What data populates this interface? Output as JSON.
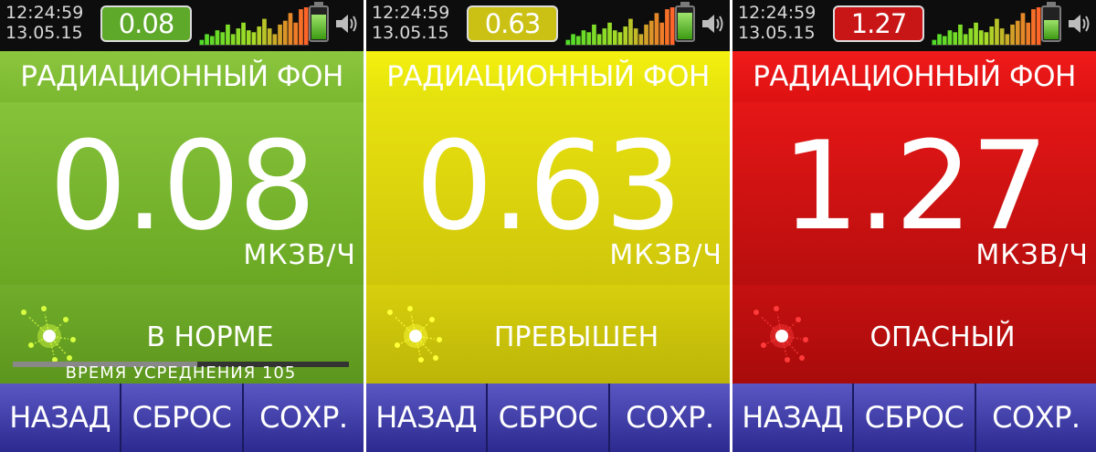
{
  "screens": [
    {
      "theme": "green",
      "time": "12:24:59",
      "date": "13.05.15",
      "mini_value": "0.08",
      "title": "РАДИАЦИОННЫЙ ФОН",
      "reading": "0.08",
      "unit": "МКЗВ/Ч",
      "state": "В НОРМЕ",
      "averaging": "ВРЕМЯ УСРЕДНЕНИЯ 105",
      "averaging_progress": 0.55,
      "icon_color": "#d8ff40",
      "buttons": [
        "НАЗАД",
        "СБРОС",
        "СОХР."
      ]
    },
    {
      "theme": "yellow",
      "time": "12:24:59",
      "date": "13.05.15",
      "mini_value": "0.63",
      "title": "РАДИАЦИОННЫЙ ФОН",
      "reading": "0.63",
      "unit": "МКЗВ/Ч",
      "state": "ПРЕВЫШЕН",
      "icon_color": "#ffff3a",
      "buttons": [
        "НАЗАД",
        "СБРОС",
        "СОХР."
      ]
    },
    {
      "theme": "red",
      "time": "12:24:59",
      "date": "13.05.15",
      "mini_value": "1.27",
      "title": "РАДИАЦИОННЫЙ ФОН",
      "reading": "1.27",
      "unit": "МКЗВ/Ч",
      "state": "ОПАСНЫЙ",
      "icon_color": "#ff3a3a",
      "buttons": [
        "НАЗАД",
        "СБРОС",
        "СОХР."
      ]
    }
  ],
  "colors": {
    "button_top": "#5a57c4",
    "button_bottom": "#2c2a8f",
    "status_bar": "#0d0d0d"
  },
  "sparkline": [
    0.15,
    0.3,
    0.25,
    0.4,
    0.35,
    0.55,
    0.3,
    0.45,
    0.6,
    0.4,
    0.35,
    0.5,
    0.7,
    0.45,
    0.3,
    0.55,
    0.65,
    0.85,
    0.6,
    0.95,
    1.0
  ]
}
